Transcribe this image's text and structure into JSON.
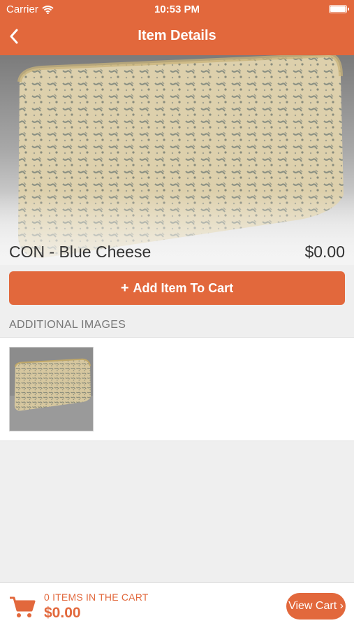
{
  "status_bar": {
    "carrier": "Carrier",
    "time": "10:53 PM"
  },
  "nav": {
    "title": "Item Details",
    "back_icon": "chevron-left-icon"
  },
  "product": {
    "name": "CON - Blue Cheese",
    "price": "$0.00"
  },
  "add_button": {
    "icon": "+",
    "label": "Add Item To Cart"
  },
  "additional_images": {
    "heading": "ADDITIONAL IMAGES"
  },
  "footer": {
    "items_text": "0 ITEMS IN THE CART",
    "total": "$0.00",
    "view_cart_label": "View Cart ›"
  },
  "colors": {
    "accent": "#e2683c",
    "background": "#efefef"
  }
}
